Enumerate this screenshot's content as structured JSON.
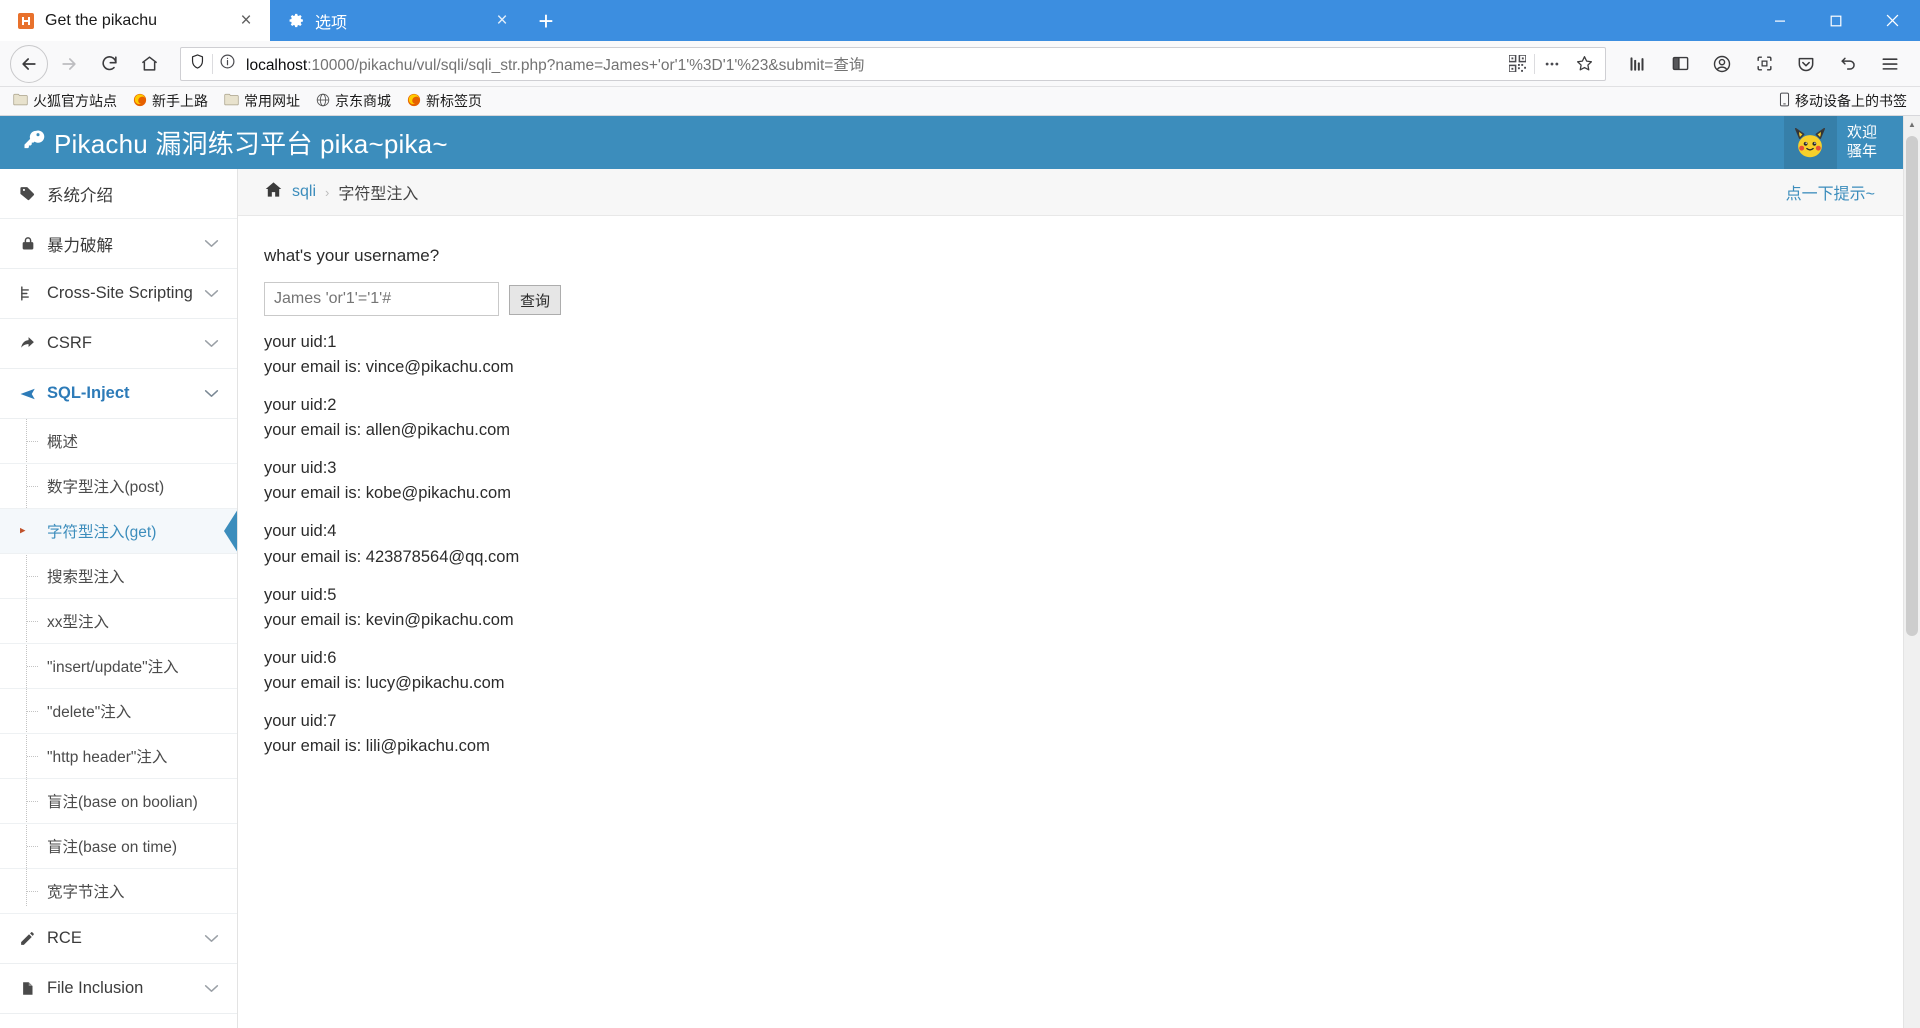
{
  "browser": {
    "tabs": [
      {
        "title": "Get the pikachu",
        "favicon": "pikachu-favicon",
        "active": true,
        "close_label": "×"
      },
      {
        "title": "选项",
        "favicon": "gear-icon",
        "active": false,
        "close_label": "×"
      }
    ],
    "new_tab_label": "+",
    "window_controls": {
      "minimize": "—",
      "maximize": "❐",
      "close": "✕"
    },
    "nav": {
      "back": "←",
      "forward": "→",
      "reload": "⟳",
      "home": "⌂"
    },
    "url": {
      "host": "localhost",
      "rest": ":10000/pikachu/vul/sqli/sqli_str.php?name=James+'or'1'%3D'1'%23&submit=查询",
      "full": "localhost:10000/pikachu/vul/sqli/sqli_str.php?name=James+'or'1'%3D'1'%23&submit=查询",
      "shield_icon": "shield-icon",
      "info_icon": "info-icon",
      "qr_icon": "qrcode-icon",
      "more_icon": "ellipsis-icon",
      "bookmark_icon": "star-icon"
    },
    "toolbar_right": [
      {
        "name": "library-icon",
        "glyph": "library"
      },
      {
        "name": "sidebar-icon",
        "glyph": "sidebar"
      },
      {
        "name": "account-icon",
        "glyph": "account"
      },
      {
        "name": "screenshot-icon",
        "glyph": "screenshot"
      },
      {
        "name": "pocket-icon",
        "glyph": "pocket"
      },
      {
        "name": "undo-icon",
        "glyph": "undo"
      },
      {
        "name": "menu-icon",
        "glyph": "menu"
      }
    ],
    "bookmarks": [
      {
        "label": "火狐官方站点",
        "icon": "folder-icon"
      },
      {
        "label": "新手上路",
        "icon": "firefox-icon"
      },
      {
        "label": "常用网址",
        "icon": "folder-icon"
      },
      {
        "label": "京东商城",
        "icon": "globe-icon"
      },
      {
        "label": "新标签页",
        "icon": "firefox-icon"
      }
    ],
    "bookmarks_right": {
      "label": "移动设备上的书签",
      "icon": "mobile-icon"
    }
  },
  "site": {
    "title": "Pikachu 漏洞练习平台 pika~pika~",
    "title_icon": "key-icon",
    "welcome_line1": "欢迎",
    "welcome_line2": "骚年",
    "header_bg": "#3c8dbc"
  },
  "sidebar": {
    "items": [
      {
        "label": "系统介绍",
        "icon": "tag-icon",
        "expandable": false,
        "active": false
      },
      {
        "label": "暴力破解",
        "icon": "lock-icon",
        "expandable": true,
        "active": false
      },
      {
        "label": "Cross-Site Scripting",
        "icon": "xss-icon",
        "expandable": true,
        "active": false
      },
      {
        "label": "CSRF",
        "icon": "share-icon",
        "expandable": true,
        "active": false
      },
      {
        "label": "SQL-Inject",
        "icon": "plane-icon",
        "expandable": true,
        "active": true
      }
    ],
    "sql_submenu": [
      {
        "label": "概述",
        "active": false
      },
      {
        "label": "数字型注入(post)",
        "active": false
      },
      {
        "label": "字符型注入(get)",
        "active": true
      },
      {
        "label": "搜索型注入",
        "active": false
      },
      {
        "label": "xx型注入",
        "active": false
      },
      {
        "label": "\"insert/update\"注入",
        "active": false
      },
      {
        "label": "\"delete\"注入",
        "active": false
      },
      {
        "label": "\"http header\"注入",
        "active": false
      },
      {
        "label": "盲注(base on boolian)",
        "active": false
      },
      {
        "label": "盲注(base on time)",
        "active": false
      },
      {
        "label": "宽字节注入",
        "active": false
      }
    ],
    "items_after": [
      {
        "label": "RCE",
        "icon": "pencil-icon",
        "expandable": true
      },
      {
        "label": "File Inclusion",
        "icon": "file-icon",
        "expandable": true
      }
    ],
    "chevron": "⌄",
    "active_color": "#3c8dbc"
  },
  "breadcrumb": {
    "home_icon": "home-icon",
    "link": "sqli",
    "separator": "›",
    "current": "字符型注入",
    "hint": "点一下提示~"
  },
  "main": {
    "prompt": "what's your username?",
    "input_value": "James 'or'1'='1'#",
    "input_placeholder": "James 'or'1'='1'#",
    "submit_label": "查询",
    "results": [
      {
        "uid": "your uid:1",
        "email": "your email is: vince@pikachu.com"
      },
      {
        "uid": "your uid:2",
        "email": "your email is: allen@pikachu.com"
      },
      {
        "uid": "your uid:3",
        "email": "your email is: kobe@pikachu.com"
      },
      {
        "uid": "your uid:4",
        "email": "your email is: 423878564@qq.com"
      },
      {
        "uid": "your uid:5",
        "email": "your email is: kevin@pikachu.com"
      },
      {
        "uid": "your uid:6",
        "email": "your email is: lucy@pikachu.com"
      },
      {
        "uid": "your uid:7",
        "email": "your email is: lili@pikachu.com"
      }
    ]
  },
  "scrollbar": {
    "up": "▲",
    "down": "▼"
  }
}
